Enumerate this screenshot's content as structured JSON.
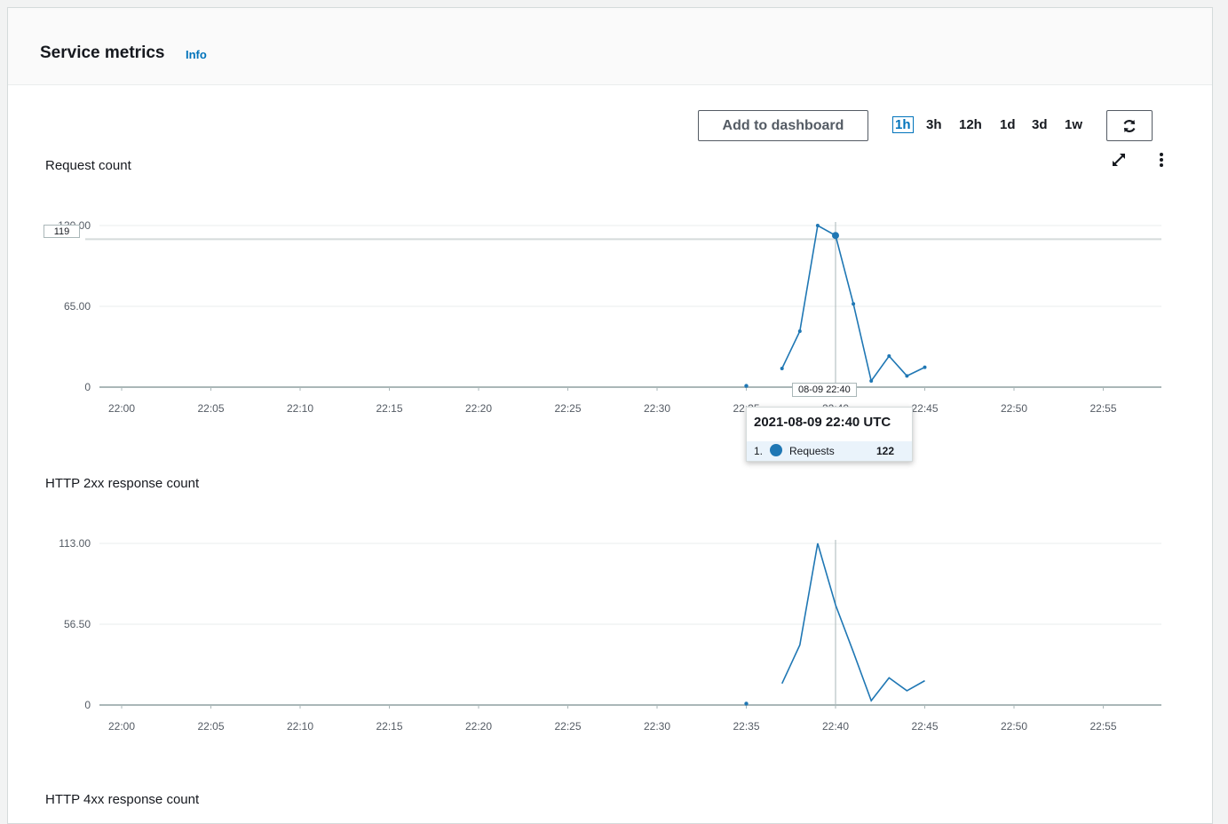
{
  "panel": {
    "title": "Service metrics",
    "info_label": "Info"
  },
  "toolbar": {
    "add_to_dashboard_label": "Add to dashboard",
    "ranges": [
      "1h",
      "3h",
      "12h",
      "1d",
      "3d",
      "1w"
    ],
    "selected_range": "1h",
    "refresh_icon": "refresh-icon",
    "expand_icon": "expand-icon",
    "more_icon": "more-options-icon"
  },
  "colors": {
    "series": "#1f77b4",
    "accent": "#0073bb"
  },
  "chart_data": [
    {
      "type": "line",
      "title": "Request count",
      "x_ticks": [
        "22:00",
        "22:05",
        "22:10",
        "22:15",
        "22:20",
        "22:25",
        "22:30",
        "22:35",
        "22:40",
        "22:45",
        "22:50",
        "22:55"
      ],
      "y_ticks": [
        "0",
        "65.00",
        "130.00"
      ],
      "ylim": [
        0,
        130
      ],
      "threshold_label": "119",
      "threshold": 119,
      "series": [
        {
          "name": "Requests",
          "points": [
            {
              "x": "22:35",
              "y": 1
            },
            {
              "x": "22:37",
              "y": 15
            },
            {
              "x": "22:38",
              "y": 45
            },
            {
              "x": "22:39",
              "y": 130
            },
            {
              "x": "22:40",
              "y": 122
            },
            {
              "x": "22:41",
              "y": 67
            },
            {
              "x": "22:42",
              "y": 5
            },
            {
              "x": "22:43",
              "y": 25
            },
            {
              "x": "22:44",
              "y": 9
            },
            {
              "x": "22:45",
              "y": 16
            }
          ]
        }
      ],
      "crosshair_x": "22:40",
      "crosshair_label": "08-09 22:40",
      "tooltip": {
        "title": "2021-08-09 22:40 UTC",
        "index": "1.",
        "series": "Requests",
        "value": "122"
      }
    },
    {
      "type": "line",
      "title": "HTTP 2xx response count",
      "x_ticks": [
        "22:00",
        "22:05",
        "22:10",
        "22:15",
        "22:20",
        "22:25",
        "22:30",
        "22:35",
        "22:40",
        "22:45",
        "22:50",
        "22:55"
      ],
      "y_ticks": [
        "0",
        "56.50",
        "113.00"
      ],
      "ylim": [
        0,
        113
      ],
      "series": [
        {
          "points": [
            {
              "x": "22:35",
              "y": 1
            },
            {
              "x": "22:37",
              "y": 15
            },
            {
              "x": "22:38",
              "y": 42
            },
            {
              "x": "22:39",
              "y": 113
            },
            {
              "x": "22:40",
              "y": 70
            },
            {
              "x": "22:41",
              "y": 37
            },
            {
              "x": "22:42",
              "y": 3
            },
            {
              "x": "22:43",
              "y": 19
            },
            {
              "x": "22:44",
              "y": 10
            },
            {
              "x": "22:45",
              "y": 17
            }
          ]
        }
      ],
      "crosshair_x": "22:40"
    },
    {
      "type": "line",
      "title": "HTTP 4xx response count"
    }
  ]
}
